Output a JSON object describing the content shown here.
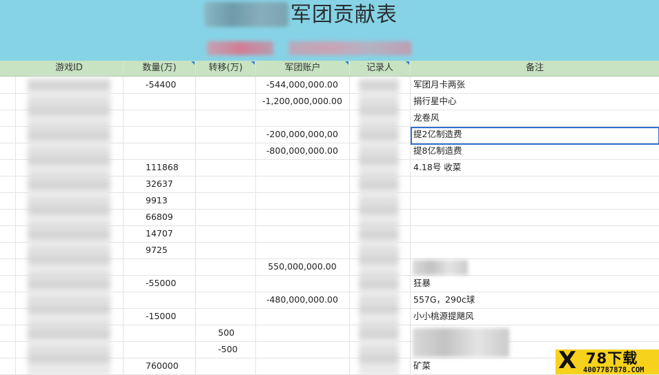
{
  "sheet": {
    "title": "军团贡献表",
    "columns": [
      "游戏ID",
      "数量(万)",
      "转移(万)",
      "军团账户",
      "记录人",
      "备注"
    ],
    "rows": [
      {
        "qty": "-54400",
        "xfer": "",
        "acct": "-544,000,000.00",
        "note": "军团月卡两张"
      },
      {
        "qty": "",
        "xfer": "",
        "acct": "-1,200,000,000.00",
        "note": "捐行星中心"
      },
      {
        "qty": "",
        "xfer": "",
        "acct": "",
        "note": "龙卷风"
      },
      {
        "qty": "",
        "xfer": "",
        "acct": "-200,000,000,00",
        "note": "提2亿制造费"
      },
      {
        "qty": "",
        "xfer": "",
        "acct": "-800,000,000.00",
        "note": "提8亿制造费"
      },
      {
        "qty": "111868",
        "xfer": "",
        "acct": "",
        "note": "4.18号 收菜"
      },
      {
        "qty": "32637",
        "xfer": "",
        "acct": "",
        "note": ""
      },
      {
        "qty": "9913",
        "xfer": "",
        "acct": "",
        "note": ""
      },
      {
        "qty": "66809",
        "xfer": "",
        "acct": "",
        "note": ""
      },
      {
        "qty": "14707",
        "xfer": "",
        "acct": "",
        "note": ""
      },
      {
        "qty": "9725",
        "xfer": "",
        "acct": "",
        "note": ""
      },
      {
        "qty": "",
        "xfer": "",
        "acct": "550,000,000.00",
        "note": ""
      },
      {
        "qty": "-55000",
        "xfer": "",
        "acct": "",
        "note": "狂暴"
      },
      {
        "qty": "",
        "xfer": "",
        "acct": "-480,000,000.00",
        "note": "557G，290c球"
      },
      {
        "qty": "-15000",
        "xfer": "",
        "acct": "",
        "note": "小小桃源提飓风"
      },
      {
        "qty": "",
        "xfer": "500",
        "acct": "",
        "note": ""
      },
      {
        "qty": "",
        "xfer": "-500",
        "acct": "",
        "note": ""
      },
      {
        "qty": "760000",
        "xfer": "",
        "acct": "",
        "note": "矿菜"
      }
    ]
  },
  "watermark": {
    "letter": "X",
    "name": "78下载",
    "url": "4007787878.COM"
  },
  "colors": {
    "banner": "#87d3e6",
    "header": "#c7e3c1",
    "selection": "#2f6fd0",
    "logo": "#f7d21c"
  }
}
